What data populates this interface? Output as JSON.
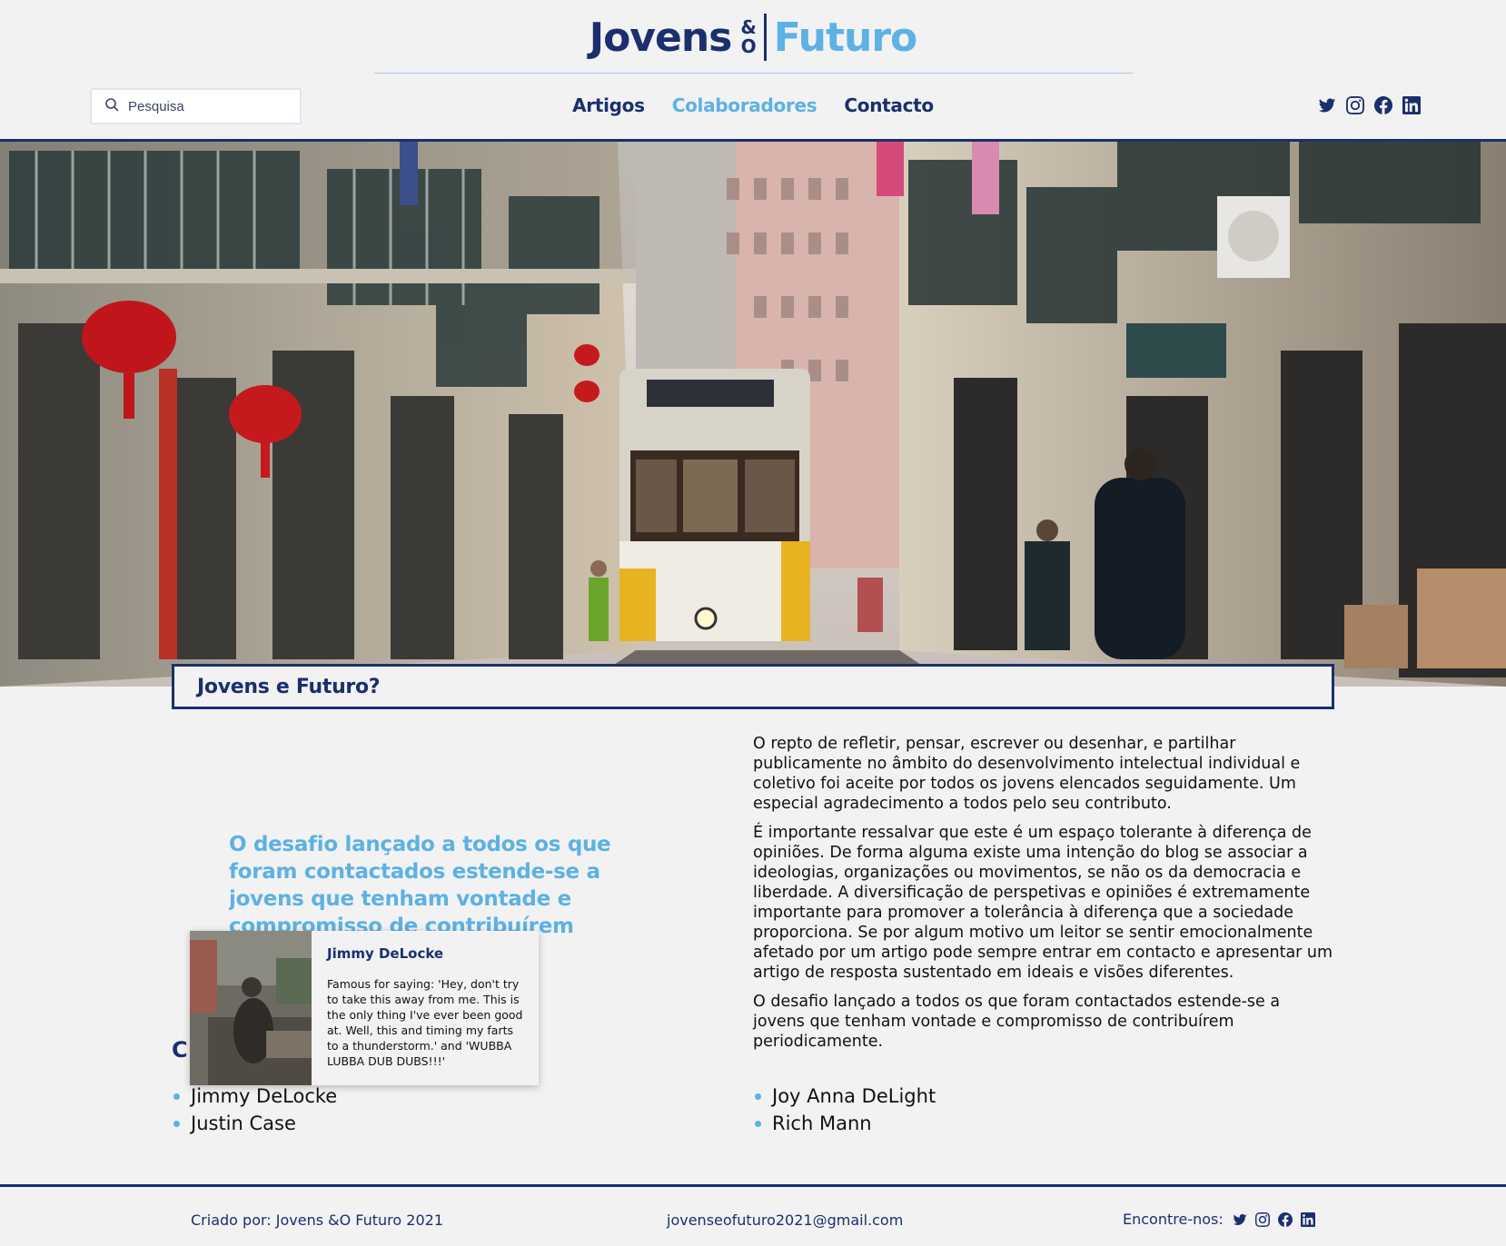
{
  "logo": {
    "part1": "Jovens",
    "amp_top": "&",
    "amp_bottom": "O",
    "part2": "Futuro"
  },
  "search": {
    "placeholder": "Pesquisa",
    "icon": "search-icon"
  },
  "nav": [
    {
      "label": "Artigos",
      "active": false
    },
    {
      "label": "Colaboradores",
      "active": true
    },
    {
      "label": "Contacto",
      "active": false
    }
  ],
  "social": [
    "twitter-icon",
    "instagram-icon",
    "facebook-icon",
    "linkedin-icon"
  ],
  "hero": {
    "description": "Lisbon street with yellow tram"
  },
  "intro": {
    "heading": "Jovens e Futuro?"
  },
  "pullquote": "O desafio lançado a todos os que foram contactados estende-se a jovens que tenham vontade e compromisso de contribuírem periodicamente.",
  "body": [
    "O repto de refletir, pensar, escrever ou desenhar, e partilhar publicamente no âmbito do desenvolvimento intelectual individual e coletivo foi aceite por todos os jovens elencados seguidamente. Um especial agradecimento a todos pelo seu contributo.",
    "É importante ressalvar que este é um espaço tolerante à diferença de opiniões. De forma alguma existe uma intenção do blog se associar a ideologias, organizações ou movimentos, se não os da democracia e liberdade. A diversificação de perspetivas e opiniões é extremamente importante para promover a tolerância à diferença que a sociedade proporciona. Se por algum motivo um leitor se sentir emocionalmente afetado por um artigo pode sempre entrar em contacto e apresentar um artigo de resposta sustentado em ideais e visões diferentes.",
    "O desafio lançado a todos os que foram contactados estende-se a jovens que tenham vontade e compromisso de contribuírem periodicamente."
  ],
  "collaborators": {
    "title_visible": "C",
    "left": [
      "Jimmy DeLocke",
      "Justin Case"
    ],
    "right": [
      "Joy Anna DeLight",
      "Rich Mann"
    ]
  },
  "card": {
    "name": "Jimmy DeLocke",
    "description": "Famous for saying: 'Hey, don't try to take this away from me. This is the only thing I've ever been good at. Well, this and timing my farts to a thunderstorm.' and 'WUBBA LUBBA DUB DUBS!!!'"
  },
  "footer": {
    "credit": "Criado por: Jovens &O Futuro 2021",
    "email": "jovenseofuturo2021@gmail.com",
    "find_label": "Encontre-nos:"
  },
  "colors": {
    "navy": "#1b2f6e",
    "accent": "#5db1e4",
    "background": "#f2f2f2"
  }
}
